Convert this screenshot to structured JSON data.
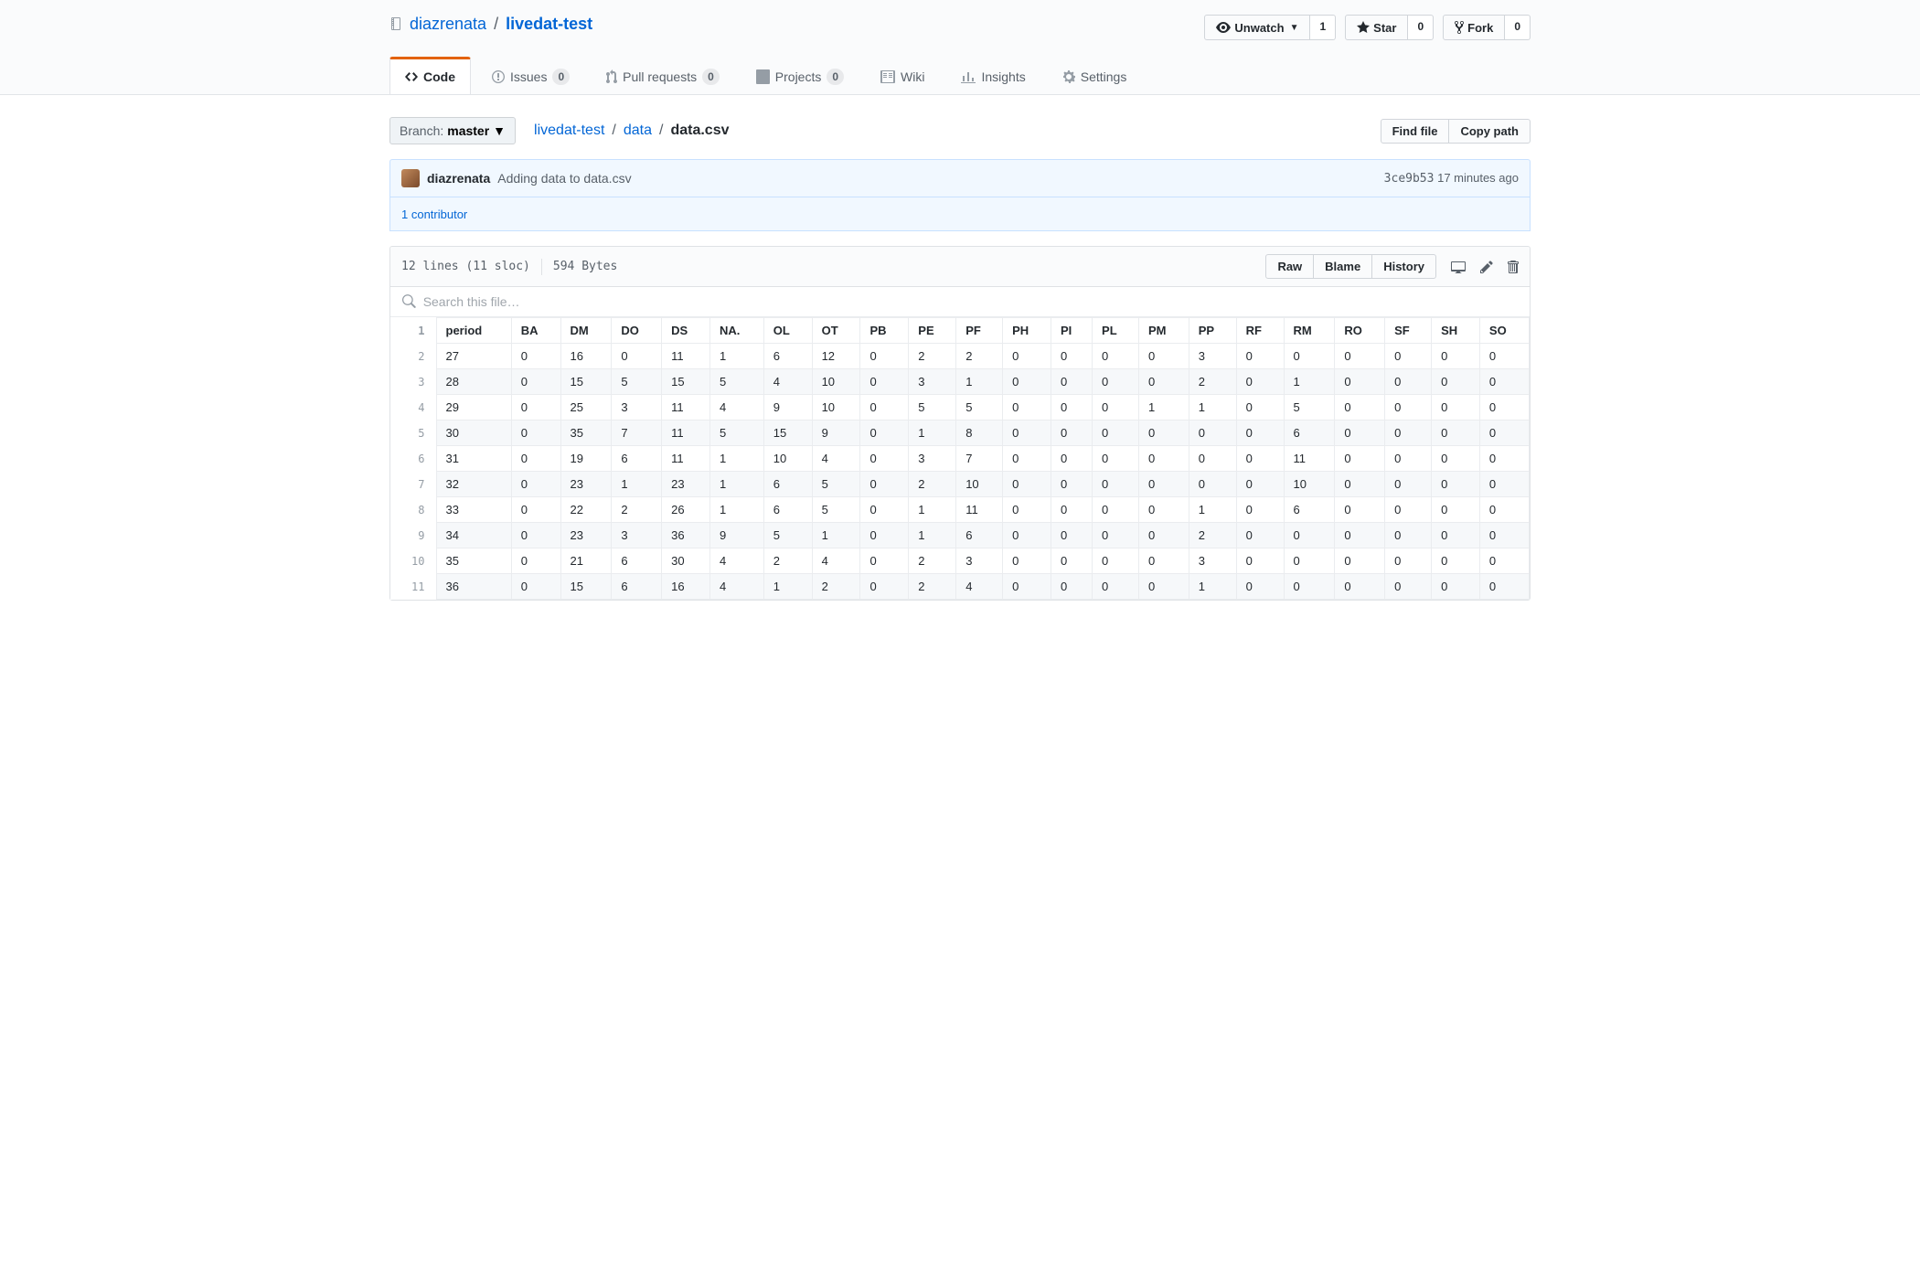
{
  "repo": {
    "owner": "diazrenata",
    "name": "livedat-test"
  },
  "actions": {
    "watch": {
      "label": "Unwatch",
      "count": "1"
    },
    "star": {
      "label": "Star",
      "count": "0"
    },
    "fork": {
      "label": "Fork",
      "count": "0"
    }
  },
  "tabs": {
    "code": {
      "label": "Code"
    },
    "issues": {
      "label": "Issues",
      "count": "0"
    },
    "pulls": {
      "label": "Pull requests",
      "count": "0"
    },
    "projects": {
      "label": "Projects",
      "count": "0"
    },
    "wiki": {
      "label": "Wiki"
    },
    "insights": {
      "label": "Insights"
    },
    "settings": {
      "label": "Settings"
    }
  },
  "branch": {
    "label": "Branch:",
    "name": "master"
  },
  "breadcrumb": {
    "root": "livedat-test",
    "folder": "data",
    "file": "data.csv"
  },
  "rightbuttons": {
    "find": "Find file",
    "copy": "Copy path"
  },
  "commit": {
    "author": "diazrenata",
    "message": "Adding data to data.csv",
    "sha": "3ce9b53",
    "time": "17 minutes ago",
    "contributors": "1 contributor"
  },
  "fileinfo": {
    "lines": "12 lines (11 sloc)",
    "size": "594 Bytes"
  },
  "fileactions": {
    "raw": "Raw",
    "blame": "Blame",
    "history": "History"
  },
  "search": {
    "placeholder": "Search this file…"
  },
  "csv": {
    "headers": [
      "period",
      "BA",
      "DM",
      "DO",
      "DS",
      "NA.",
      "OL",
      "OT",
      "PB",
      "PE",
      "PF",
      "PH",
      "PI",
      "PL",
      "PM",
      "PP",
      "RF",
      "RM",
      "RO",
      "SF",
      "SH",
      "SO"
    ],
    "rows": [
      [
        "27",
        "0",
        "16",
        "0",
        "11",
        "1",
        "6",
        "12",
        "0",
        "2",
        "2",
        "0",
        "0",
        "0",
        "0",
        "3",
        "0",
        "0",
        "0",
        "0",
        "0",
        "0"
      ],
      [
        "28",
        "0",
        "15",
        "5",
        "15",
        "5",
        "4",
        "10",
        "0",
        "3",
        "1",
        "0",
        "0",
        "0",
        "0",
        "2",
        "0",
        "1",
        "0",
        "0",
        "0",
        "0"
      ],
      [
        "29",
        "0",
        "25",
        "3",
        "11",
        "4",
        "9",
        "10",
        "0",
        "5",
        "5",
        "0",
        "0",
        "0",
        "1",
        "1",
        "0",
        "5",
        "0",
        "0",
        "0",
        "0"
      ],
      [
        "30",
        "0",
        "35",
        "7",
        "11",
        "5",
        "15",
        "9",
        "0",
        "1",
        "8",
        "0",
        "0",
        "0",
        "0",
        "0",
        "0",
        "6",
        "0",
        "0",
        "0",
        "0"
      ],
      [
        "31",
        "0",
        "19",
        "6",
        "11",
        "1",
        "10",
        "4",
        "0",
        "3",
        "7",
        "0",
        "0",
        "0",
        "0",
        "0",
        "0",
        "11",
        "0",
        "0",
        "0",
        "0"
      ],
      [
        "32",
        "0",
        "23",
        "1",
        "23",
        "1",
        "6",
        "5",
        "0",
        "2",
        "10",
        "0",
        "0",
        "0",
        "0",
        "0",
        "0",
        "10",
        "0",
        "0",
        "0",
        "0"
      ],
      [
        "33",
        "0",
        "22",
        "2",
        "26",
        "1",
        "6",
        "5",
        "0",
        "1",
        "11",
        "0",
        "0",
        "0",
        "0",
        "1",
        "0",
        "6",
        "0",
        "0",
        "0",
        "0"
      ],
      [
        "34",
        "0",
        "23",
        "3",
        "36",
        "9",
        "5",
        "1",
        "0",
        "1",
        "6",
        "0",
        "0",
        "0",
        "0",
        "2",
        "0",
        "0",
        "0",
        "0",
        "0",
        "0"
      ],
      [
        "35",
        "0",
        "21",
        "6",
        "30",
        "4",
        "2",
        "4",
        "0",
        "2",
        "3",
        "0",
        "0",
        "0",
        "0",
        "3",
        "0",
        "0",
        "0",
        "0",
        "0",
        "0"
      ],
      [
        "36",
        "0",
        "15",
        "6",
        "16",
        "4",
        "1",
        "2",
        "0",
        "2",
        "4",
        "0",
        "0",
        "0",
        "0",
        "1",
        "0",
        "0",
        "0",
        "0",
        "0",
        "0"
      ]
    ]
  }
}
